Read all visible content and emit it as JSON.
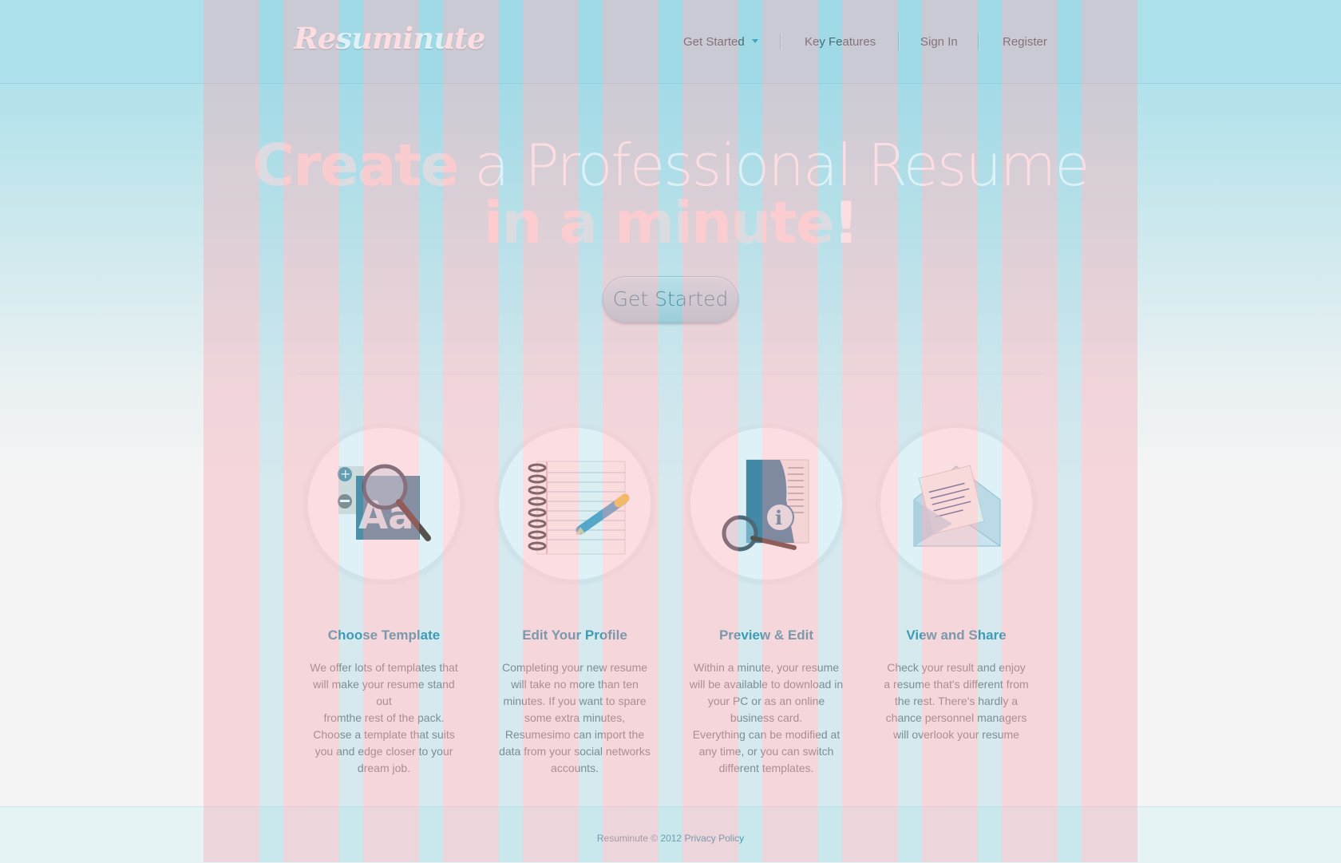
{
  "header": {
    "logo": "Resuminute",
    "nav": [
      {
        "label": "Get Started"
      },
      {
        "label": "Key Features"
      },
      {
        "label": "Sign In"
      },
      {
        "label": "Register"
      }
    ]
  },
  "hero": {
    "line1_bold": "Create",
    "line1_rest": " a Professional Resume",
    "line2_bold": "in a minute",
    "line2_end": "!",
    "cta": "Get Started"
  },
  "features": [
    {
      "icon": "font-magnifier-icon",
      "title": "Choose Template",
      "text": "We offer lots of templates that\nwill make your resume stand out\nfromthe rest of the pack.\nChoose a template that suits\nyou and edge closer to your\ndream job."
    },
    {
      "icon": "notebook-pencil-icon",
      "title": "Edit  Your Profile",
      "text": "Completing your new resume\nwill take no more than ten\nminutes. If you want to spare\nsome extra minutes,\nResumesimo can import the\ndata from your social networks\naccounts."
    },
    {
      "icon": "info-book-icon",
      "title": "Preview & Edit",
      "text": "Within a minute, your resume\nwill be available to download in\nyour PC or as an online\nbusiness card.\nEverything can be modified at\nany time, or you can switch\ndifferent templates."
    },
    {
      "icon": "envelope-letter-icon",
      "title": "View and Share",
      "text": "Check your result and enjoy\na resume that's different from\nthe rest. There's hardly a\nchance personnel managers\nwill overlook your resume"
    }
  ],
  "footer": {
    "copyright": "Resuminute © 2012",
    "privacy": "Privacy Policy"
  },
  "colors": {
    "header_bg": "#ace0ea",
    "accent": "#2a8da6",
    "stripe_pink": "rgba(248,170,180,0.40)",
    "stripe_blue": "rgba(120,200,220,0.25)"
  }
}
